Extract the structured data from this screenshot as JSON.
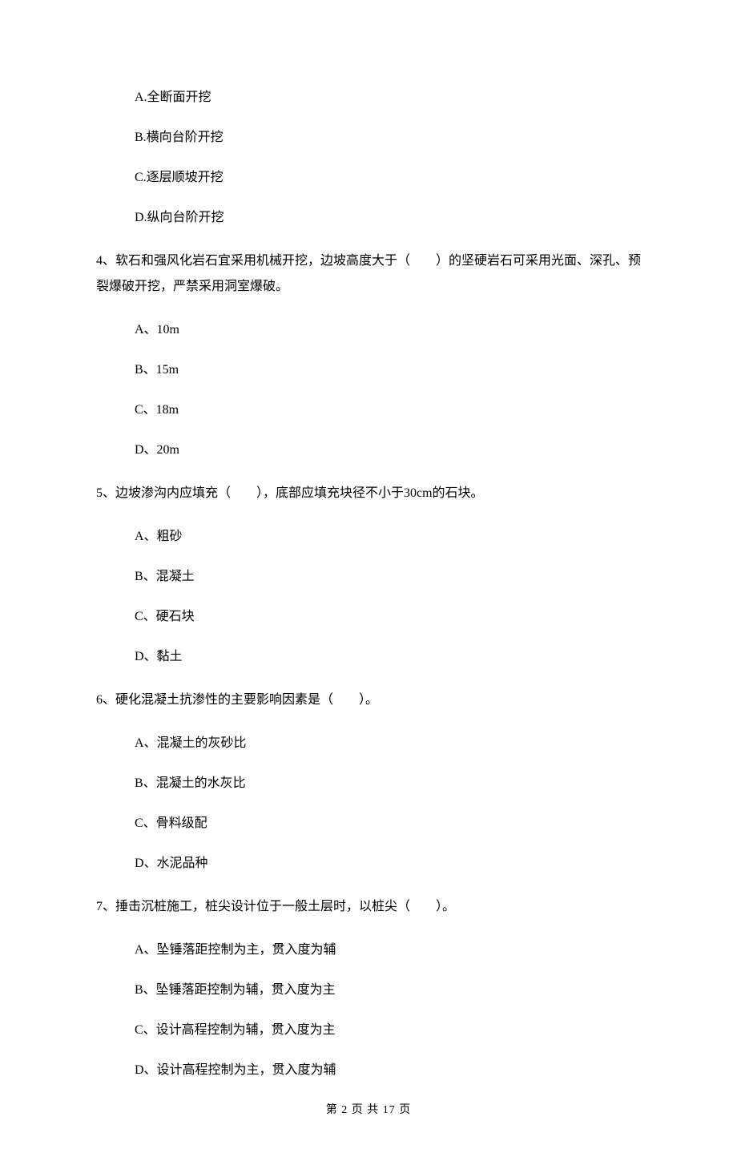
{
  "q3": {
    "opts": {
      "a": "A.全断面开挖",
      "b": "B.横向台阶开挖",
      "c": "C.逐层顺坡开挖",
      "d": "D.纵向台阶开挖"
    }
  },
  "q4": {
    "stem": "4、软石和强风化岩石宜采用机械开挖，边坡高度大于（　　）的坚硬岩石可采用光面、深孔、预裂爆破开挖，严禁采用洞室爆破。",
    "opts": {
      "a": "A、10m",
      "b": "B、15m",
      "c": "C、18m",
      "d": "D、20m"
    }
  },
  "q5": {
    "stem": "5、边坡渗沟内应填充（　　），底部应填充块径不小于30cm的石块。",
    "opts": {
      "a": "A、粗砂",
      "b": "B、混凝土",
      "c": "C、硬石块",
      "d": "D、黏土"
    }
  },
  "q6": {
    "stem": "6、硬化混凝土抗渗性的主要影响因素是（　　）。",
    "opts": {
      "a": "A、混凝土的灰砂比",
      "b": "B、混凝土的水灰比",
      "c": "C、骨料级配",
      "d": "D、水泥品种"
    }
  },
  "q7": {
    "stem": "7、捶击沉桩施工，桩尖设计位于一般土层时，以桩尖（　　）。",
    "opts": {
      "a": "A、坠锤落距控制为主，贯入度为辅",
      "b": "B、坠锤落距控制为辅，贯入度为主",
      "c": "C、设计高程控制为辅，贯入度为主",
      "d": "D、设计高程控制为主，贯入度为辅"
    }
  },
  "footer": "第 2 页 共 17 页"
}
